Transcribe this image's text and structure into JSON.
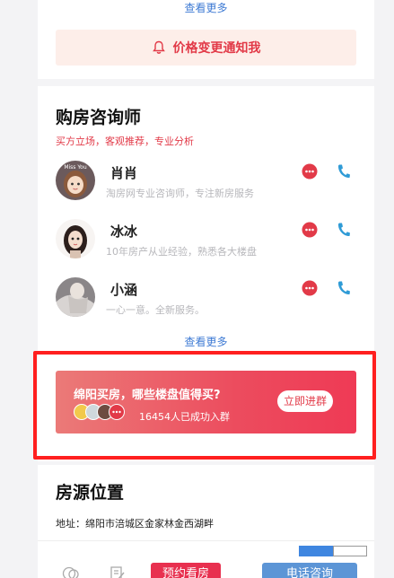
{
  "top_card": {
    "see_more": "查看更多",
    "notify_label": "价格变更通知我"
  },
  "consultants": {
    "title": "购房咨询师",
    "subtitle": "买方立场，客观推荐，专业分析",
    "items": [
      {
        "name": "肖肖",
        "desc": "淘房网专业咨询师，专注新房服务",
        "avatar_text": "Miss You"
      },
      {
        "name": "冰冰",
        "desc": "10年房产从业经验，熟悉各大楼盘"
      },
      {
        "name": "小涵",
        "desc": "一心一意。全新服务。"
      }
    ],
    "see_more": "查看更多"
  },
  "group_banner": {
    "title": "绵阳买房，哪些楼盘值得买?",
    "count_text": "16454人已成功入群",
    "join_label": "立即进群"
  },
  "location": {
    "title": "房源位置",
    "address": "地址：绵阳市涪城区金家林金西湖畔"
  },
  "bottom_bar": {
    "visit_label": "预约看房",
    "call_label": "电话咨询"
  },
  "colors": {
    "accent_red": "#e23a48",
    "link_blue": "#3f7bd4",
    "highlight_red": "#ff1f1f"
  }
}
